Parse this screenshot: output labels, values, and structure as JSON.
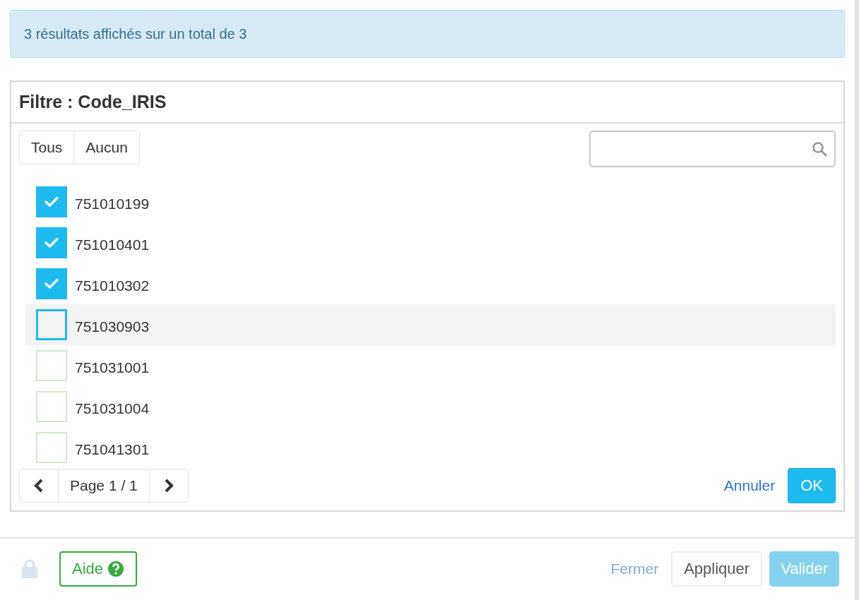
{
  "alert": {
    "text": "3 résultats affichés sur un total de 3"
  },
  "filter": {
    "title": "Filtre : Code_IRIS",
    "select_buttons": [
      "Tous",
      "Aucun"
    ],
    "items": [
      {
        "label": "751010199",
        "checked": true,
        "focused": false
      },
      {
        "label": "751010401",
        "checked": true,
        "focused": false
      },
      {
        "label": "751010302",
        "checked": true,
        "focused": false
      },
      {
        "label": "751030903",
        "checked": false,
        "focused": true
      },
      {
        "label": "751031001",
        "checked": false,
        "focused": false
      },
      {
        "label": "751031004",
        "checked": false,
        "focused": false
      },
      {
        "label": "751041301",
        "checked": false,
        "focused": false
      }
    ],
    "pagination": {
      "label": "Page 1 / 1"
    },
    "cancel": "Annuler",
    "ok": "OK"
  },
  "footer": {
    "help": "Aide",
    "close": {
      "label": "Fermer",
      "disabled": true
    },
    "apply": {
      "label": "Appliquer",
      "disabled": false
    },
    "validate": {
      "label": "Valider",
      "disabled": true
    }
  }
}
